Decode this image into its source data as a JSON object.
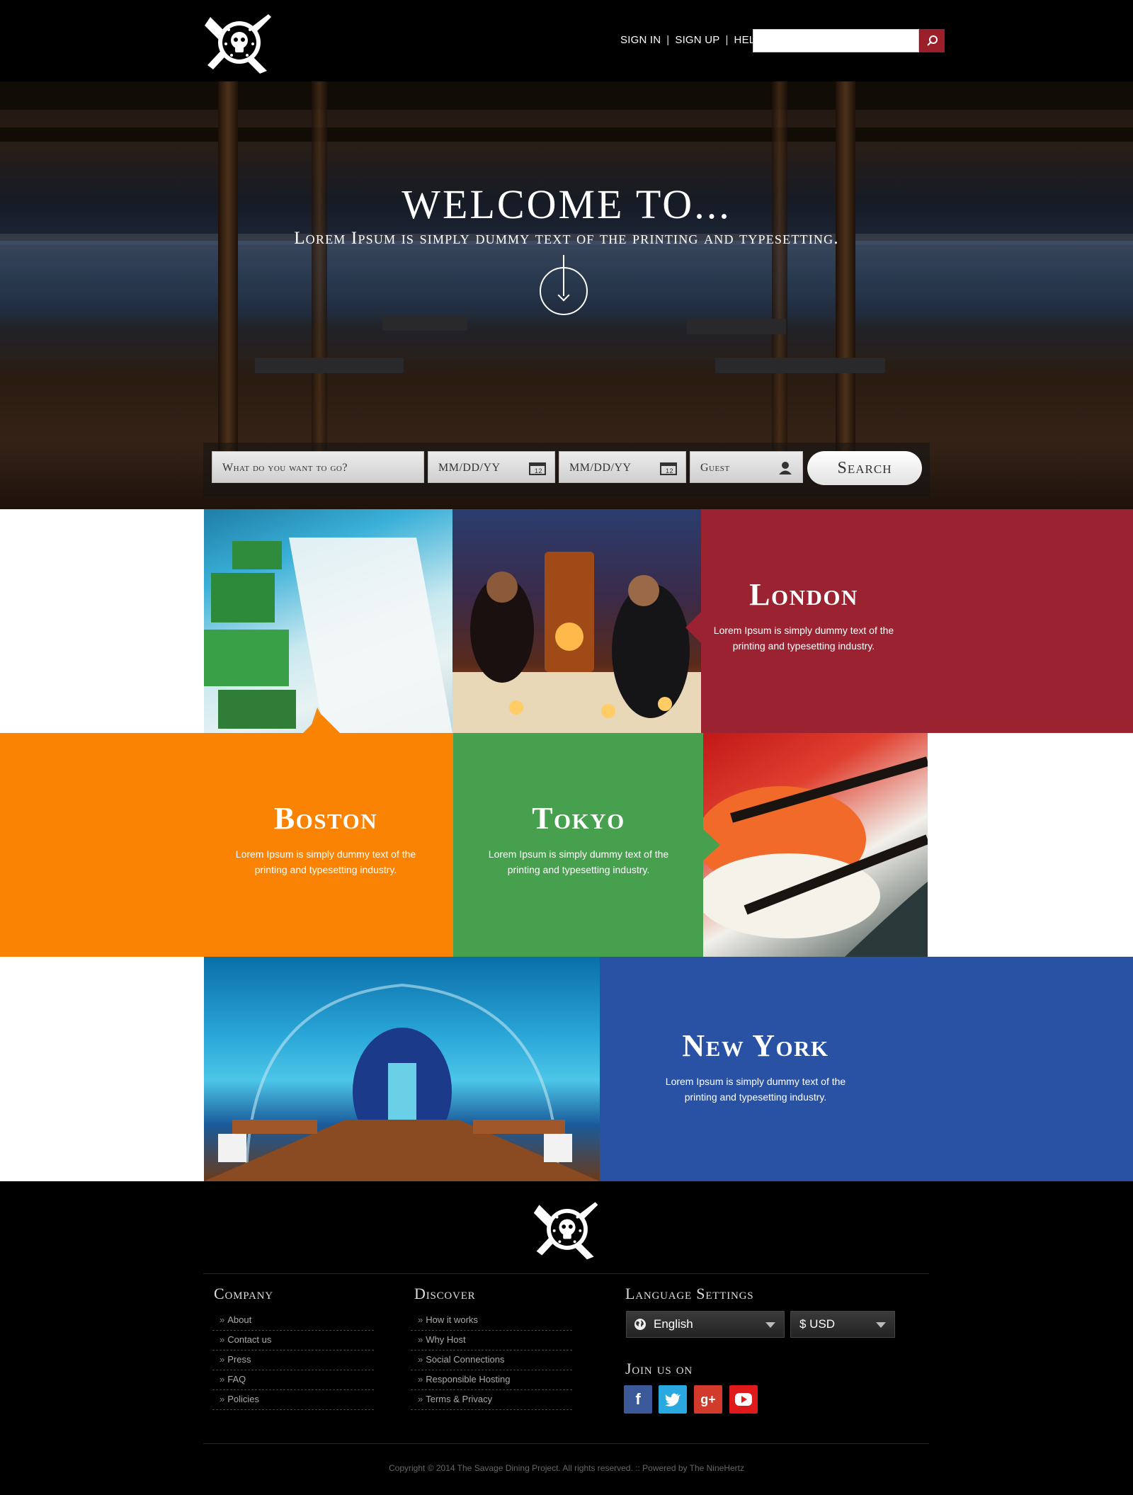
{
  "header": {
    "nav": [
      "SIGN IN",
      "SIGN UP",
      "HELP"
    ],
    "search_placeholder": ""
  },
  "hero": {
    "title": "WELCOME TO...",
    "subtitle": "Lorem Ipsum is simply dummy text of the printing and typesetting.",
    "search": {
      "destination_placeholder": "What do you want to go?",
      "checkin_placeholder": "MM/DD/YY",
      "checkout_placeholder": "MM/DD/YY",
      "guest_placeholder": "Guest",
      "search_label": "Search"
    }
  },
  "cities": [
    {
      "name": "London",
      "text": "Lorem Ipsum is simply dummy text of the printing and typesetting industry.",
      "color": "#9b2230"
    },
    {
      "name": "Boston",
      "text": "Lorem Ipsum is simply dummy text of the printing and typesetting industry.",
      "color": "#fb8303"
    },
    {
      "name": "Tokyo",
      "text": "Lorem Ipsum is simply dummy text of the printing and typesetting industry.",
      "color": "#46a04e"
    },
    {
      "name": "New York",
      "text": "Lorem Ipsum is simply dummy text of the printing and typesetting industry.",
      "color": "#2a52a4"
    }
  ],
  "footer": {
    "company": {
      "heading": "Company",
      "items": [
        "About",
        "Contact us",
        "Press",
        "FAQ",
        "Policies"
      ]
    },
    "discover": {
      "heading": "Discover",
      "items": [
        "How it works",
        "Why Host",
        "Social Connections",
        "Responsible Hosting",
        "Terms & Privacy"
      ]
    },
    "language": {
      "heading": "Language Settings",
      "language_value": "English",
      "currency_value": "$ USD"
    },
    "join": {
      "heading": "Join us on"
    },
    "social": [
      "facebook-icon",
      "twitter-icon",
      "google-plus-icon",
      "youtube-icon"
    ],
    "copyright": "Copyright © 2014  The Savage Dining Project. All rights reserved.   ::   Powered by The NineHertz"
  }
}
